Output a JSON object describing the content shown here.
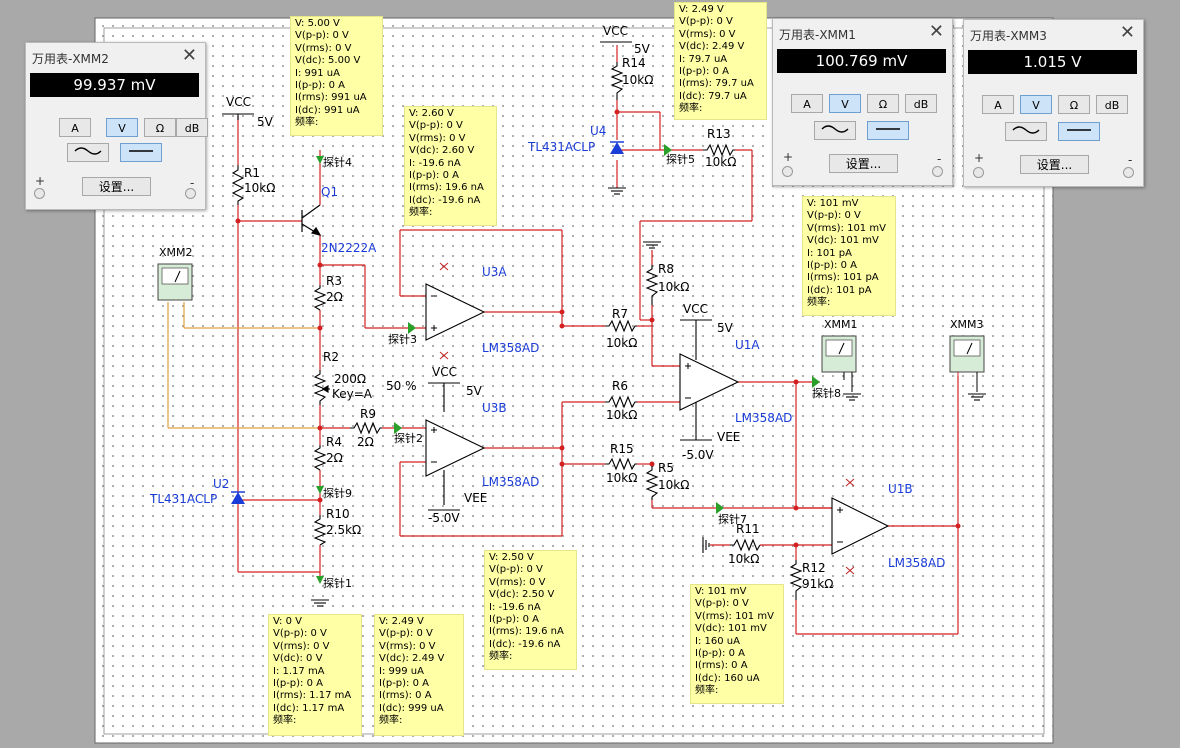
{
  "components": {
    "vcc_labels": [
      "VCC",
      "VCC",
      "VCC",
      "VCC"
    ],
    "v5": [
      "5V",
      "5V",
      "5V",
      "5V"
    ],
    "vee_labels": [
      "VEE",
      "VEE"
    ],
    "vneg5": [
      "-5.0V",
      "-5.0V"
    ],
    "R1": {
      "ref": "R1",
      "val": "10kΩ"
    },
    "R2": {
      "ref": "R2",
      "val": "200Ω",
      "key": "Key=A",
      "pct": "50 %"
    },
    "R3": {
      "ref": "R3",
      "val": "2Ω"
    },
    "R4": {
      "ref": "R4",
      "val": "2Ω"
    },
    "R5": {
      "ref": "R5",
      "val": "10kΩ"
    },
    "R6": {
      "ref": "R6",
      "val": "10kΩ"
    },
    "R7": {
      "ref": "R7",
      "val": "10kΩ"
    },
    "R8": {
      "ref": "R8",
      "val": "10kΩ"
    },
    "R9": {
      "ref": "R9",
      "val": "2Ω"
    },
    "R10": {
      "ref": "R10",
      "val": "2.5kΩ"
    },
    "R11": {
      "ref": "R11",
      "val": "10kΩ"
    },
    "R12": {
      "ref": "R12",
      "val": "91kΩ"
    },
    "R13": {
      "ref": "R13",
      "val": "10kΩ"
    },
    "R14": {
      "ref": "R14",
      "val": "10kΩ"
    },
    "R15": {
      "ref": "R15",
      "val": "10kΩ"
    },
    "Q1": {
      "ref": "Q1",
      "model": "2N2222A"
    },
    "U2": {
      "ref": "U2",
      "model": "TL431ACLP"
    },
    "U4": {
      "ref": "U4",
      "model": "TL431ACLP"
    },
    "U3A": {
      "ref": "U3A",
      "model": "LM358AD"
    },
    "U3B": {
      "ref": "U3B",
      "model": "LM358AD"
    },
    "U1A": {
      "ref": "U1A",
      "model": "LM358AD"
    },
    "U1B": {
      "ref": "U1B",
      "model": "LM358AD"
    },
    "XMM1": "XMM1",
    "XMM2": "XMM2",
    "XMM3": "XMM3",
    "probes": {
      "p1": "探针1",
      "p2": "探针2",
      "p3": "探针3",
      "p4": "探针4",
      "p5": "探针5",
      "p7": "探针7",
      "p8": "探针8",
      "p9": "探针9"
    }
  },
  "tooltips": [
    {
      "id": "probe4",
      "lines": [
        "V: 5.00 V",
        "V(p-p): 0 V",
        "V(rms): 0 V",
        "V(dc): 5.00 V",
        "I: 991 uA",
        "I(p-p): 0 A",
        "I(rms): 991 uA",
        "I(dc): 991 uA",
        "频率:"
      ]
    },
    {
      "id": "probe3",
      "lines": [
        "V: 2.60 V",
        "V(p-p): 0 V",
        "V(rms): 0 V",
        "V(dc): 2.60 V",
        "I: -19.6 nA",
        "I(p-p): 0 A",
        "I(rms): 19.6 nA",
        "I(dc): -19.6 nA",
        "频率:"
      ]
    },
    {
      "id": "probe5",
      "lines": [
        "V: 2.49 V",
        "V(p-p): 0 V",
        "V(rms): 0 V",
        "V(dc): 2.49 V",
        "I: 79.7 uA",
        "I(p-p): 0 A",
        "I(rms): 79.7 uA",
        "I(dc): 79.7 uA",
        "频率:"
      ]
    },
    {
      "id": "probe8",
      "lines": [
        "V: 101 mV",
        "V(p-p): 0 V",
        "V(rms): 101 mV",
        "V(dc): 101 mV",
        "I: 101 pA",
        "I(p-p): 0 A",
        "I(rms): 101 pA",
        "I(dc): 101 pA",
        "频率:"
      ]
    },
    {
      "id": "probe2",
      "lines": [
        "V: 2.50 V",
        "V(p-p): 0 V",
        "V(rms): 0 V",
        "V(dc): 2.50 V",
        "I: -19.6 nA",
        "I(p-p): 0 A",
        "I(rms): 19.6 nA",
        "I(dc): -19.6 nA",
        "频率:"
      ]
    },
    {
      "id": "probe7",
      "lines": [
        "V: 101 mV",
        "V(p-p): 0 V",
        "V(rms): 101 mV",
        "V(dc): 101 mV",
        "I: 160 uA",
        "I(p-p): 0 A",
        "I(rms): 0 A",
        "I(dc): 160 uA",
        "频率:"
      ]
    },
    {
      "id": "probe1",
      "lines": [
        "V: 0 V",
        "V(p-p): 0 V",
        "V(rms): 0 V",
        "V(dc): 0 V",
        "I: 1.17 mA",
        "I(p-p): 0 A",
        "I(rms): 1.17 mA",
        "I(dc): 1.17 mA",
        "频率:"
      ]
    },
    {
      "id": "probe9",
      "lines": [
        "V: 2.49 V",
        "V(p-p): 0 V",
        "V(rms): 0 V",
        "V(dc): 2.49 V",
        "I: 999 uA",
        "I(p-p): 0 A",
        "I(rms): 0 A",
        "I(dc): 999 uA",
        "频率:"
      ]
    }
  ],
  "meters": {
    "xmm2": {
      "title": "万用表-XMM2",
      "reading": "99.937 mV"
    },
    "xmm1": {
      "title": "万用表-XMM1",
      "reading": "100.769 mV"
    },
    "xmm3": {
      "title": "万用表-XMM3",
      "reading": "1.015 V"
    },
    "buttons": {
      "a": "A",
      "v": "V",
      "ohm": "Ω",
      "db": "dB",
      "settings": "设置...",
      "plus": "+",
      "minus": "-",
      "close": "✕"
    },
    "colors": {
      "active": "#cde3f7",
      "display_bg": "#000000"
    }
  },
  "colors": {
    "wire": "#d42020",
    "wire_meter": "#e0a040",
    "label_blue": "#1a3cd8",
    "probe": "#2aa02a",
    "tooltip": "#ffffa6"
  }
}
